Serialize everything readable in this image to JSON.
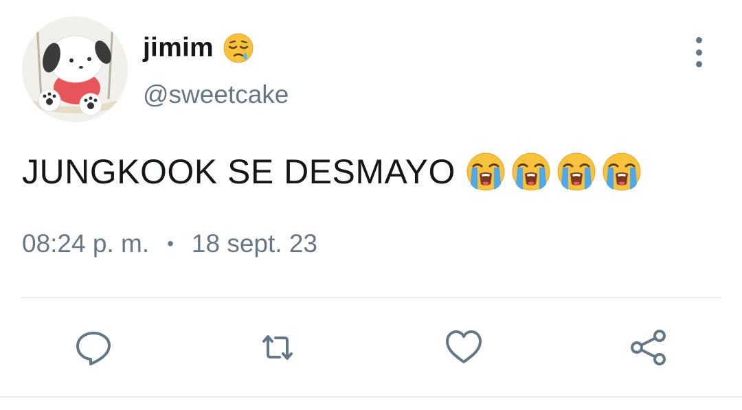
{
  "tweet": {
    "display_name": "jimim",
    "name_emoji": "sleepy-face-emoji",
    "handle": "@sweetcake",
    "text": "JUNGKOOK SE DESMAYO",
    "text_emojis": [
      "loudly-crying-face-emoji",
      "loudly-crying-face-emoji",
      "loudly-crying-face-emoji",
      "loudly-crying-face-emoji"
    ],
    "time": "08:24 p. m.",
    "separator": "•",
    "date": "18 sept. 23"
  },
  "actions": [
    {
      "name": "reply",
      "icon": "reply-icon"
    },
    {
      "name": "retweet",
      "icon": "retweet-icon"
    },
    {
      "name": "like",
      "icon": "heart-icon"
    },
    {
      "name": "share",
      "icon": "share-icon"
    }
  ],
  "colors": {
    "text_primary": "#14171a",
    "text_secondary": "#657786",
    "divider": "#e6ecf0"
  }
}
